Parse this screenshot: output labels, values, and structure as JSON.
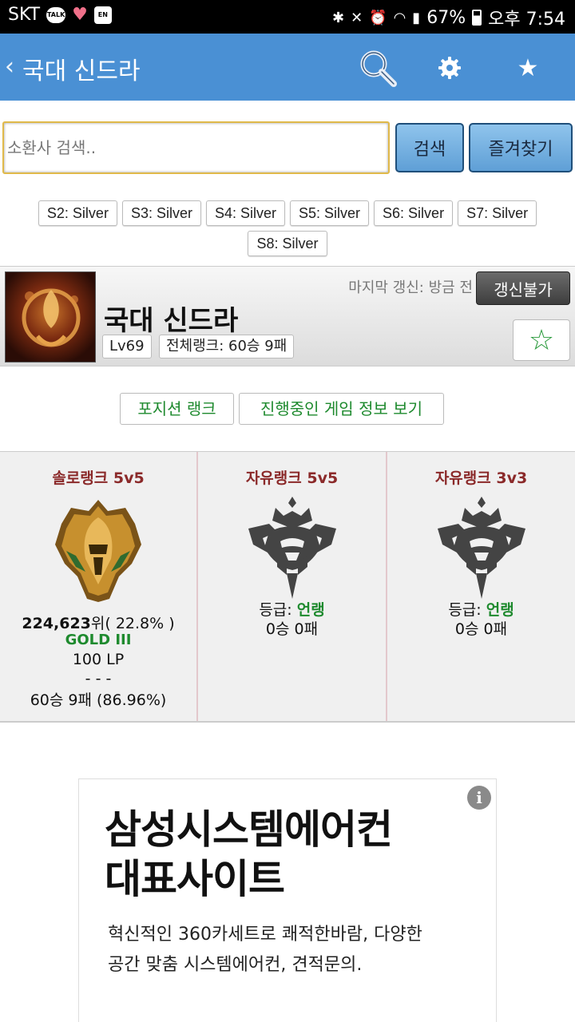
{
  "status_bar": {
    "carrier": "SKT",
    "talk_badge": "TALK",
    "en_badge": "EN",
    "battery": "67%",
    "time": "오후 7:54"
  },
  "app_bar": {
    "back_icon": "chevron-left-icon",
    "title": "국대 신드라",
    "icons": [
      "search-icon",
      "gear-icon",
      "star-icon"
    ]
  },
  "search": {
    "placeholder": "소환사 검색..",
    "search_label": "검색",
    "favorites_label": "즐겨찾기"
  },
  "seasons": [
    "S2: Silver",
    "S3: Silver",
    "S4: Silver",
    "S5: Silver",
    "S6: Silver",
    "S7: Silver",
    "S8: Silver"
  ],
  "profile": {
    "name": "국대 신드라",
    "level": "Lv69",
    "total_rank": "전체랭크: 60승 9패",
    "last_update": "마지막 갱신: 방금 전",
    "refresh_label": "갱신불가",
    "favorite_icon": "☆"
  },
  "actions": {
    "position_rank": "포지션 랭크",
    "live_game": "진행중인 게임 정보 보기"
  },
  "ranks": {
    "solo": {
      "title": "솔로랭크 5v5",
      "rank_num": "224,623",
      "rank_suffix": "위( 22.8% )",
      "tier": "GOLD III",
      "lp": "100 LP",
      "sep": "- - -",
      "record": "60승 9패 (86.96%)"
    },
    "flex5": {
      "title": "자유랭크 5v5",
      "grade_label": "등급: ",
      "grade": "언랭",
      "record": "0승 0패"
    },
    "flex3": {
      "title": "자유랭크 3v3",
      "grade_label": "등급: ",
      "grade": "언랭",
      "record": "0승 0패"
    }
  },
  "ad": {
    "headline_1": "삼성시스템에어컨",
    "headline_2": "대표사이트",
    "body_1": "혁신적인 360카세트로 쾌적한바람, 다양한",
    "body_2": "공간 맞춤 시스템에어컨, 견적문의.",
    "info_icon": "i"
  },
  "colors": {
    "app_bar": "#4a90d4",
    "rank_title": "#8b2a2a",
    "green": "#1e8a2e"
  }
}
